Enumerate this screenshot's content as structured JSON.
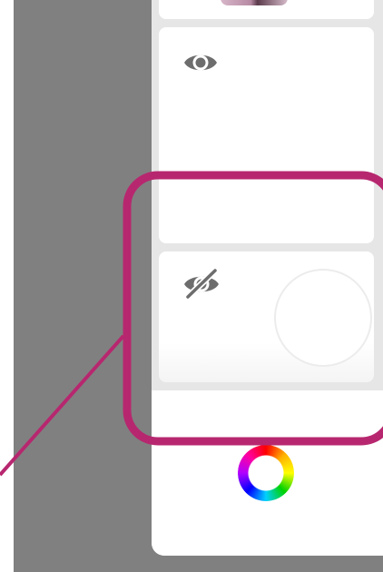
{
  "icons": {
    "visible_layer": "eye-icon",
    "hidden_layer": "eye-off-icon",
    "color_picker": "color-wheel-icon"
  },
  "colors": {
    "background": "#808080",
    "panel": "#e6e6e6",
    "card": "#ffffff",
    "icon": "#6d6d6d",
    "annotation": "#b7276f"
  }
}
